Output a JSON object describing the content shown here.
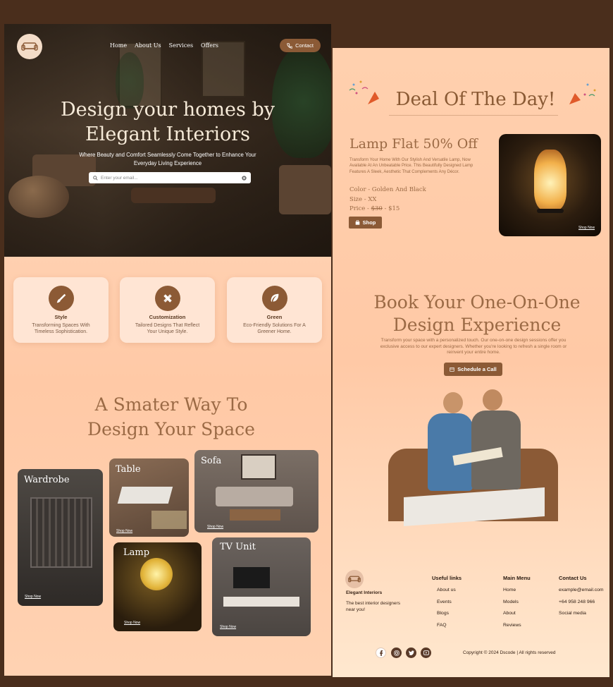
{
  "nav": {
    "items": [
      "Home",
      "About Us",
      "Services",
      "Offers"
    ],
    "contact": "Contact"
  },
  "hero": {
    "title_line1": "Design your homes by",
    "title_line2": "Elegant Interiors",
    "subtitle": "Where Beauty and Comfort Seamlessly Come Together to Enhance Your Everyday Living Experience",
    "search_placeholder": "Enter your email..."
  },
  "features": [
    {
      "title": "Style",
      "desc": "Transforming Spaces With Timeless Sophistication.",
      "icon": "brush-icon"
    },
    {
      "title": "Customization",
      "desc": "Tailored Designs That Reflect Your Unique Style.",
      "icon": "ruler-pencil-icon"
    },
    {
      "title": "Green",
      "desc": "Eco-Friendly Solutions For A Greener Home.",
      "icon": "leaf-icon"
    }
  ],
  "smart": {
    "line1": "A Smater Way To",
    "line2": "Design Your Space"
  },
  "categories": {
    "wardrobe": "Wardrobe",
    "table": "Table",
    "sofa": "Sofa",
    "lamp": "Lamp",
    "tv": "TV Unit",
    "shop_now": "Shop Now"
  },
  "deal": {
    "title": "Deal Of The Day!",
    "product": "Lamp Flat 50% Off",
    "desc": "Transform Your Home With Our Stylish And Versatile Lamp, Now Available At An Unbeatable Price. This Beautifully Designed Lamp Features A Sleek, Aesthetic That Complements Any Décor.",
    "color": "Color - Golden And Black",
    "size": "Size - XX",
    "price_prefix": "Price - ",
    "price_old": "$30",
    "price_new": " - $15",
    "shop": "Shop",
    "shop_now": "Shop Now"
  },
  "book": {
    "line1": "Book Your One-On-One",
    "line2": "Design Experience",
    "desc": "Transform your space with a personalized touch. Our one-on-one design sessions offer you exclusive access to our expert designers. Whether you're looking to refresh a single room or reinvent your entire home.",
    "cta": "Schedule a Call"
  },
  "footer": {
    "brand": "Elegant Interiors",
    "tagline": "The best interior designers near you!",
    "useful_title": "Useful links",
    "useful": [
      "About us",
      "Events",
      "Blogs",
      "FAQ"
    ],
    "menu_title": "Main Menu",
    "menu": [
      "Home",
      "Models",
      "About",
      "Reviews"
    ],
    "contact_title": "Contact Us",
    "contact": [
      "example@email.com",
      "+64 958 248 966",
      "Social media"
    ],
    "copyright": "Copyright © 2024 Dscode | All rights reserved"
  },
  "colors": {
    "accent": "#8b5a36",
    "heading": "#9b6a45",
    "bg": "#4a2e1c",
    "page": "#ffc9a6"
  }
}
